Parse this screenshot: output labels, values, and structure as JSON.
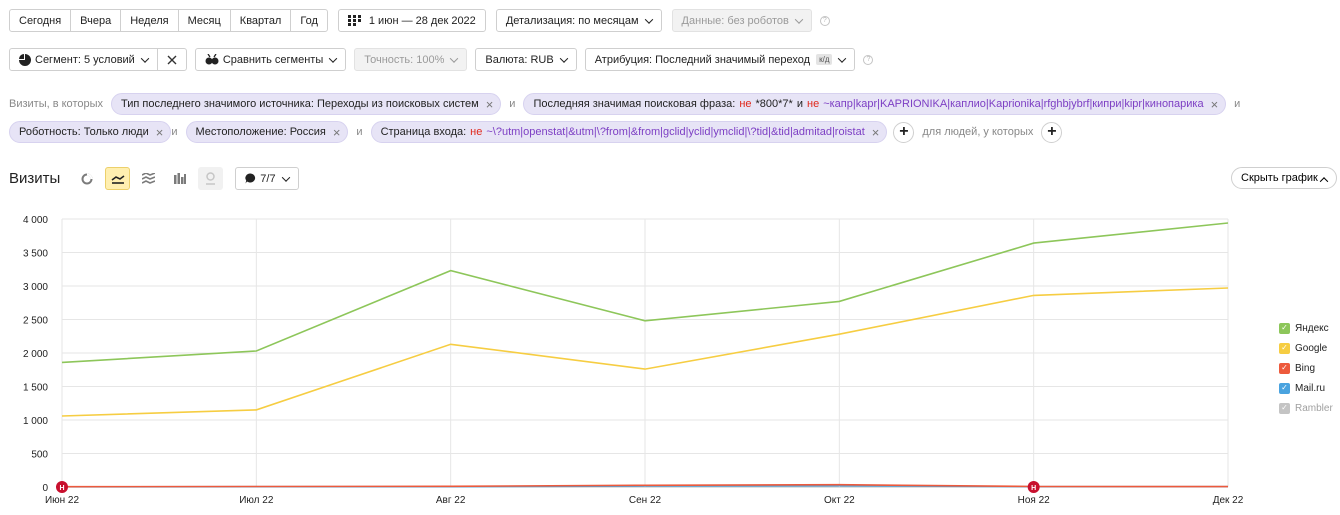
{
  "periods": [
    "Сегодня",
    "Вчера",
    "Неделя",
    "Месяц",
    "Квартал",
    "Год"
  ],
  "date_range": "1 июн — 28 дек 2022",
  "detail": "Детализация: по месяцам",
  "robots": "Данные: без роботов",
  "help_glyph": "?",
  "segment": "Сегмент: 5 условий",
  "compare": "Сравнить сегменты",
  "accuracy": "Точность: 100%",
  "currency": "Валюта: RUB",
  "attribution": "Атрибуция: Последний значимый переход",
  "attribution_badge": "к/д",
  "filters": {
    "lead": "Визиты, в которых",
    "and": "и",
    "chip1": "Тип последнего значимого источника: Переходы из поисковых систем",
    "chip2_label": "Последняя значимая поисковая фраза:",
    "not": "не",
    "chip2_v1": "*800*7*",
    "chip2_v2": "~капр|kapr|KAPRIONIKA|каплио|Kaprionika|rfghbjybrf|кипри|kipr|кинопарика",
    "chip3": "Роботность: Только люди",
    "chip4": "Местоположение: Россия",
    "chip5_label": "Страница входа:",
    "chip5_value": "~\\?utm|openstat|&utm|\\?from|&from|gclid|yclid|ymclid|\\?tid|&tid|admitad|roistat",
    "people": "для людей, у которых"
  },
  "chart_header": {
    "title": "Визиты",
    "counter": "7/7",
    "hide": "Скрыть график"
  },
  "chart_data": {
    "type": "line",
    "title": "",
    "xlabel": "",
    "ylabel": "",
    "categories": [
      "Июн 22",
      "Июл 22",
      "Авг 22",
      "Сен 22",
      "Окт 22",
      "Ноя 22",
      "Дек 22"
    ],
    "y_ticks": [
      "0",
      "500",
      "1 000",
      "1 500",
      "2 000",
      "2 500",
      "3 000",
      "3 500",
      "4 000"
    ],
    "ylim": [
      0,
      4000
    ],
    "grid": true,
    "legend_position": "right",
    "markers": [
      {
        "category": "Июн 22",
        "label": "Н"
      },
      {
        "category": "Ноя 22",
        "label": "Н"
      }
    ],
    "series": [
      {
        "name": "Яндекс",
        "color": "#8dc65a",
        "visible": true,
        "values": [
          1860,
          2030,
          3230,
          2480,
          2770,
          3640,
          3940
        ]
      },
      {
        "name": "Google",
        "color": "#f6cd42",
        "visible": true,
        "values": [
          1060,
          1150,
          2130,
          1760,
          2280,
          2860,
          2970
        ]
      },
      {
        "name": "Bing",
        "color": "#ed5a3c",
        "visible": true,
        "values": [
          5,
          8,
          10,
          25,
          35,
          8,
          6
        ]
      },
      {
        "name": "Mail.ru",
        "color": "#4aa3df",
        "visible": true,
        "values": [
          3,
          4,
          5,
          15,
          20,
          5,
          4
        ]
      },
      {
        "name": "Rambler",
        "color": "#c4c4c4",
        "visible": false,
        "values": [
          1,
          1,
          1,
          2,
          2,
          1,
          1
        ]
      }
    ]
  }
}
